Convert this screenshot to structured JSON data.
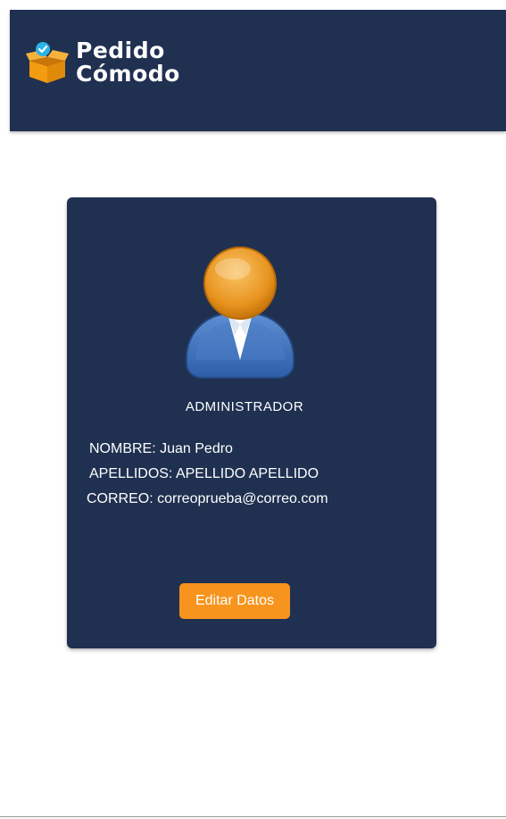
{
  "header": {
    "brand_line1": "Pedido",
    "brand_line2": "Cómodo"
  },
  "profile": {
    "role": "ADMINISTRADOR",
    "name_line": "NOMBRE: Juan Pedro",
    "surnames_line": "APELLIDOS: APELLIDO APELLIDO",
    "email_line": "CORREO: correoprueba@correo.com",
    "edit_label": "Editar Datos"
  },
  "colors": {
    "header_bg": "#1f3050",
    "card_bg": "#1f3050",
    "accent": "#f7941d",
    "text": "#ffffff"
  },
  "icons": {
    "logo": "open-box-icon",
    "avatar": "user-avatar-icon"
  }
}
